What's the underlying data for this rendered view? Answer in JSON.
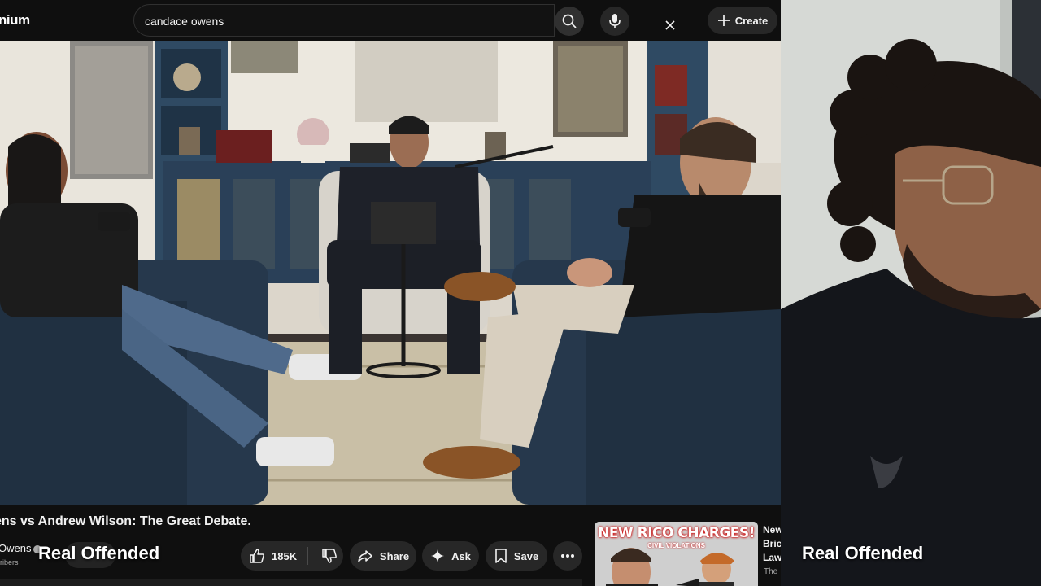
{
  "browser": {
    "logo_text": "nium",
    "search": {
      "value": "candace owens",
      "placeholder": "Search"
    },
    "create_label": "Create",
    "icons": {
      "clear": "close-icon",
      "search": "search-icon",
      "mic": "microphone-icon",
      "create": "plus-icon"
    }
  },
  "video": {
    "title": "ens vs Andrew Wilson: The Great Debate.",
    "channel_name": "Owens",
    "subscribers": "ribers",
    "actions": {
      "like_count": "185K",
      "share_label": "Share",
      "ask_label": "Ask",
      "save_label": "Save"
    }
  },
  "recommendation": {
    "thumb_title": "NEW RICO CHARGES!",
    "thumb_subtitle": "CIVIL VIOLATIONS",
    "title_lines": [
      "New",
      "Bric",
      "Law"
    ],
    "channel": "The"
  },
  "overlay": {
    "left_label": "Real Offended",
    "right_label": "Real Offended"
  },
  "colors": {
    "background": "#0f0f0f",
    "pill": "#272727",
    "text": "#f1f1f1",
    "secondary_text": "#aaaaaa",
    "thumb_accent": "#cc0000"
  }
}
